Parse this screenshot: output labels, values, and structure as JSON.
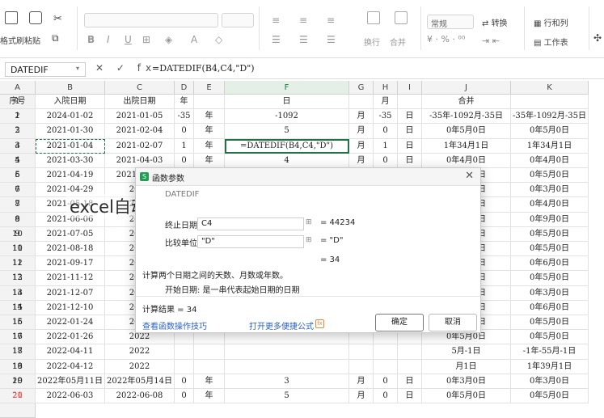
{
  "ribbon": {
    "format_painter": "格式刷",
    "paste": "粘贴",
    "number_format": "常规",
    "convert": "转换",
    "wrap": "换行",
    "merge": "合并",
    "rows_cols": "行和列",
    "worksheet": "工作表"
  },
  "formula_bar": {
    "name_box": "DATEDIF",
    "fx_symbols": "✕ ✓ fx",
    "formula": "=DATEDIF(B4,C4,\"D\")"
  },
  "columns": [
    "A",
    "B",
    "C",
    "D",
    "E",
    "F",
    "G",
    "H",
    "I",
    "J",
    "K"
  ],
  "headers": [
    "序号",
    "入院日期",
    "出院日期",
    "年",
    "",
    "日",
    "",
    "月",
    "",
    "合并",
    ""
  ],
  "rows": [
    [
      "1",
      "2024-01-02",
      "2021-01-05",
      "-35",
      "年",
      "-1092",
      "月",
      "-35",
      "日",
      "-35年-1092月-35日",
      "-35年-1092月-35日"
    ],
    [
      "2",
      "2021-01-30",
      "2021-02-04",
      "0",
      "年",
      "5",
      "月",
      "0",
      "日",
      "0年5月0日",
      "0年5月0日"
    ],
    [
      "3",
      "2021-01-04",
      "2021-02-07",
      "1",
      "年",
      "=DATEDIF(B4,C4,\"D\")",
      "月",
      "1",
      "日",
      "1年34月1日",
      "1年34月1日"
    ],
    [
      "4",
      "2021-03-30",
      "2021-04-03",
      "0",
      "年",
      "4",
      "月",
      "0",
      "日",
      "0年4月0日",
      "0年4月0日"
    ],
    [
      "5",
      "2021-04-19",
      "2021-04-24",
      "0",
      "年",
      "5",
      "月",
      "0",
      "日",
      "0年5月0日",
      "0年5月0日"
    ],
    [
      "6",
      "2021-04-29",
      "2021",
      "",
      "",
      "",
      "",
      "",
      "",
      "0年3月0日",
      "0年3月0日"
    ],
    [
      "7",
      "2021-05-18",
      "2021",
      "",
      "",
      "",
      "",
      "",
      "",
      "0年4月0日",
      "0年4月0日"
    ],
    [
      "8",
      "2021-06-06",
      "2021",
      "",
      "",
      "",
      "",
      "",
      "",
      "0年9月0日",
      "0年9月0日"
    ],
    [
      "9",
      "2021-07-05",
      "2021",
      "",
      "",
      "",
      "",
      "",
      "",
      "0年5月0日",
      "0年5月0日"
    ],
    [
      "10",
      "2021-08-18",
      "2021",
      "",
      "",
      "",
      "",
      "",
      "",
      "0年5月0日",
      "0年5月0日"
    ],
    [
      "11",
      "2021-09-17",
      "2021",
      "",
      "",
      "",
      "",
      "",
      "",
      "0年6月0日",
      "0年6月0日"
    ],
    [
      "12",
      "2021-11-12",
      "2021",
      "",
      "",
      "",
      "",
      "",
      "",
      "0年5月0日",
      "0年5月0日"
    ],
    [
      "13",
      "2021-12-07",
      "2021",
      "",
      "",
      "",
      "",
      "",
      "",
      "0年3月0日",
      "0年3月0日"
    ],
    [
      "14",
      "2021-12-10",
      "2021",
      "",
      "",
      "",
      "",
      "",
      "",
      "0年6月0日",
      "0年6月0日"
    ],
    [
      "15",
      "2022-01-24",
      "2022",
      "",
      "",
      "",
      "",
      "",
      "",
      "0年5月0日",
      "0年5月0日"
    ],
    [
      "16",
      "2022-01-26",
      "2022",
      "",
      "",
      "",
      "",
      "",
      "",
      "0年5月0日",
      "0年5月0日"
    ],
    [
      "17",
      "2022-04-11",
      "2022",
      "",
      "",
      "",
      "",
      "",
      "",
      "5月-1日",
      "-1年-55月-1日"
    ],
    [
      "18",
      "2022-04-12",
      "2022",
      "",
      "",
      "",
      "",
      "",
      "",
      "月1日",
      "1年39月1日"
    ],
    [
      "19",
      "2022年05月11日",
      "2022年05月14日",
      "0",
      "年",
      "3",
      "月",
      "0",
      "日",
      "0年3月0日",
      "0年3月0日"
    ],
    [
      "20",
      "2022-06-03",
      "2022-06-08",
      "0",
      "年",
      "5",
      "月",
      "0",
      "日",
      "0年5月0日",
      "0年5月0日"
    ]
  ],
  "dialog": {
    "title": "函数参数",
    "close": "✕",
    "arg_top_partial": "DATEDIF",
    "end_date_label": "终止日期",
    "end_date_value": "C4",
    "end_date_result": "= 44234",
    "unit_label": "比较单位",
    "unit_value": "\"D\"",
    "unit_result": "= \"D\"",
    "preview_result": "= 34",
    "description": "计算两个日期之间的天数、月数或年数。",
    "start_date_hint": "开始日期: 是一串代表起始日期的日期",
    "calc_result": "计算结果 = 34",
    "help_link": "查看函数操作技巧",
    "more_link": "打开更多便捷公式",
    "ok": "确定",
    "cancel": "取消"
  },
  "watermark": "excel自动计算月数，Excel高效计算月份差异新技巧"
}
